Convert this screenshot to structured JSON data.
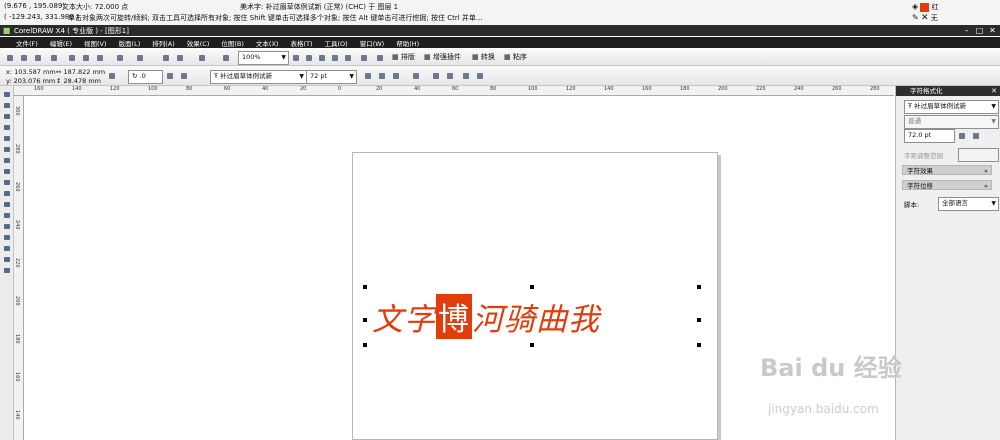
{
  "status": {
    "cursor_pos": "(9.676 , 195.089)",
    "text_size": "文本大小: 72.000 点",
    "object_desc": "美术字: 补过眉草体例试新 (正常) (CHC) 于 图层 1",
    "cursor_pos2": "( -129.243, 331.980 )",
    "hint": "单击对象两次可旋转/倾斜; 双击工具可选择所有对象; 按住 Shift 键单击可选择多个对象; 按住 Alt 键单击可进行挖掘; 按住 Ctrl 并单...",
    "fill_label": "红",
    "outline_label": "无",
    "fill_color": "#e8380d"
  },
  "window": {
    "title": "CorelDRAW X4 ( 专业版 ) - [图形1]"
  },
  "menu": [
    "文件(F)",
    "编辑(E)",
    "视图(V)",
    "版面(L)",
    "排列(A)",
    "效果(C)",
    "位图(B)",
    "文本(X)",
    "表格(T)",
    "工具(O)",
    "窗口(W)",
    "帮助(H)"
  ],
  "toolbar1": {
    "zoom": "100%",
    "btn_layout": "排版",
    "btn_plugins": "增强插件",
    "btn_convert": "转换",
    "btn_paste": "粘序"
  },
  "toolbar2": {
    "x": "x: 103.587 mm",
    "y": "y: 203.076 mm",
    "w": "187.822 mm",
    "h": "28.478 mm",
    "angle": ".0",
    "font": "补过眉草体例试新",
    "size": "72 pt"
  },
  "ruler_h": [
    "160",
    "140",
    "120",
    "100",
    "80",
    "60",
    "40",
    "20",
    "0",
    "20",
    "40",
    "60",
    "80",
    "100",
    "120",
    "140",
    "160",
    "180",
    "200",
    "220",
    "240",
    "260",
    "280",
    "300"
  ],
  "ruler_v": [
    "300",
    "280",
    "260",
    "240",
    "220",
    "200",
    "180",
    "160",
    "140"
  ],
  "canvas": {
    "art_text": "文字",
    "art_seal": "博",
    "art_rest": "河骑曲我"
  },
  "docker": {
    "title": "字符格式化",
    "font": "补过眉草体例试新",
    "style": "普通",
    "size": "72.0 pt",
    "kerning_label": "字距调整范围",
    "effects": "字符效果",
    "shift": "字符位移",
    "script_label": "脚本:",
    "script_value": "全部语言"
  },
  "watermark": {
    "brand": "Bai du 经验",
    "url": "jingyan.baidu.com"
  }
}
